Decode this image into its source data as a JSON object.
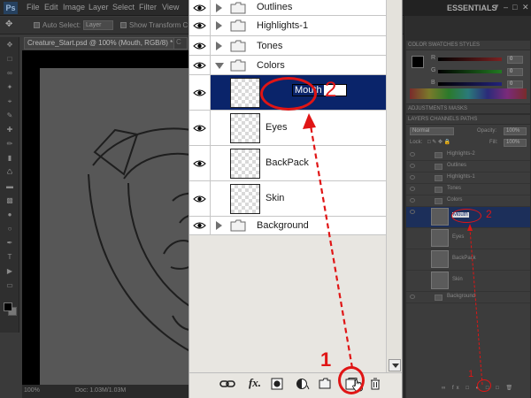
{
  "app": {
    "menu": [
      "File",
      "Edit",
      "Image",
      "Layer",
      "Select",
      "Filter",
      "View"
    ],
    "workspace_label": "ESSENTIALS",
    "options_bar": {
      "auto_select_label": "Auto Select:",
      "auto_select_value": "Layer",
      "show_transform_label": "Show Transform Controls"
    },
    "document_tab": "Creature_Start.psd @ 100% (Mouth, RGB/8) *",
    "status_zoom": "100%",
    "status_doc": "Doc: 1.03M/1.03M"
  },
  "side_panels": {
    "color_tabs": "COLOR  SWATCHES  STYLES",
    "rgb": [
      {
        "label": "R",
        "value": "0"
      },
      {
        "label": "G",
        "value": "0"
      },
      {
        "label": "B",
        "value": "0"
      }
    ],
    "adjustments_tabs": "ADJUSTMENTS  MASKS",
    "layers_tabs": "LAYERS  CHANNELS  PATHS",
    "blend_mode": "Normal",
    "opacity_label": "Opacity:",
    "opacity_value": "100%",
    "lock_label": "Lock:",
    "fill_label": "Fill:",
    "fill_value": "100%",
    "mini_layers": [
      "Highlights-2",
      "Outlines",
      "Highlights-1",
      "Tones",
      "Colors",
      "Mouth",
      "Eyes",
      "BackPack",
      "Skin",
      "Background"
    ]
  },
  "layers_panel": {
    "groups_top": [
      "Outlines",
      "Highlights-1",
      "Tones"
    ],
    "open_group": "Colors",
    "child_layers": [
      "Mouth",
      "Eyes",
      "BackPack",
      "Skin"
    ],
    "renaming_layer_value": "Mouth",
    "group_bottom": "Background",
    "bottom_icons": [
      "link-layers-icon",
      "fx-icon",
      "add-mask-icon",
      "adjustment-layer-icon",
      "new-group-icon",
      "new-layer-icon",
      "delete-layer-icon"
    ],
    "fx_label": "fx."
  },
  "annotations": {
    "step1": "1",
    "step2": "2",
    "mini_step1": "1",
    "mini_step2": "2",
    "color": "#e01515"
  },
  "colors": {
    "selected_row": "#0a246a",
    "panel_bg": "#e8e6e1"
  }
}
